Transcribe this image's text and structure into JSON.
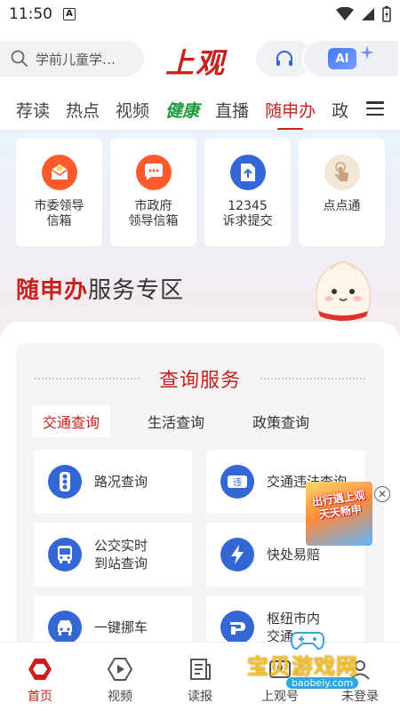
{
  "status_bar": {
    "time": "11:50",
    "notification_icon": "A"
  },
  "header": {
    "search_placeholder": "学前儿童学…",
    "logo_text": "上观",
    "ai_label": "AI"
  },
  "tabs": [
    {
      "label": "荐读"
    },
    {
      "label": "热点"
    },
    {
      "label": "视频"
    },
    {
      "label": "健康"
    },
    {
      "label": "直播"
    },
    {
      "label": "随申办"
    },
    {
      "label": "政"
    }
  ],
  "quick_services": [
    {
      "label": "市委领导\n信箱",
      "icon": "leader-mailbox-icon"
    },
    {
      "label": "市政府\n领导信箱",
      "icon": "chat-bubble-icon"
    },
    {
      "label": "12345\n诉求提交",
      "icon": "upload-file-icon"
    },
    {
      "label": "点点通",
      "icon": "tap-finger-icon"
    }
  ],
  "hero": {
    "title_red": "随申办",
    "title_rest": "服务专区"
  },
  "query_section": {
    "title": "查询服务",
    "subtabs": [
      {
        "label": "交通查询"
      },
      {
        "label": "生活查询"
      },
      {
        "label": "政策查询"
      }
    ],
    "services": [
      {
        "label": "路况查询",
        "icon": "traffic-light-icon"
      },
      {
        "label": "交通违法查询",
        "icon": "violation-icon"
      },
      {
        "label": "公交实时\n到站查询",
        "icon": "bus-icon"
      },
      {
        "label": "快处易赔",
        "icon": "lightning-icon"
      },
      {
        "label": "一键挪车",
        "icon": "car-icon"
      },
      {
        "label": "枢纽市内\n交通",
        "icon": "hub-icon"
      }
    ]
  },
  "ad": {
    "text": "出行遇上观\n天天畅申"
  },
  "bottom_nav": [
    {
      "label": "首页",
      "icon": "home-icon"
    },
    {
      "label": "视频",
      "icon": "play-icon"
    },
    {
      "label": "读报",
      "icon": "newspaper-icon"
    },
    {
      "label": "上观号",
      "icon": "account-icon"
    },
    {
      "label": "未登录",
      "icon": "user-icon"
    }
  ],
  "watermark": {
    "text": "宝贝游戏网",
    "url": "baobeiy.com"
  },
  "colors": {
    "brand_red": "#c8201c",
    "health_green": "#1b9a3c",
    "service_blue": "#3467d6"
  }
}
